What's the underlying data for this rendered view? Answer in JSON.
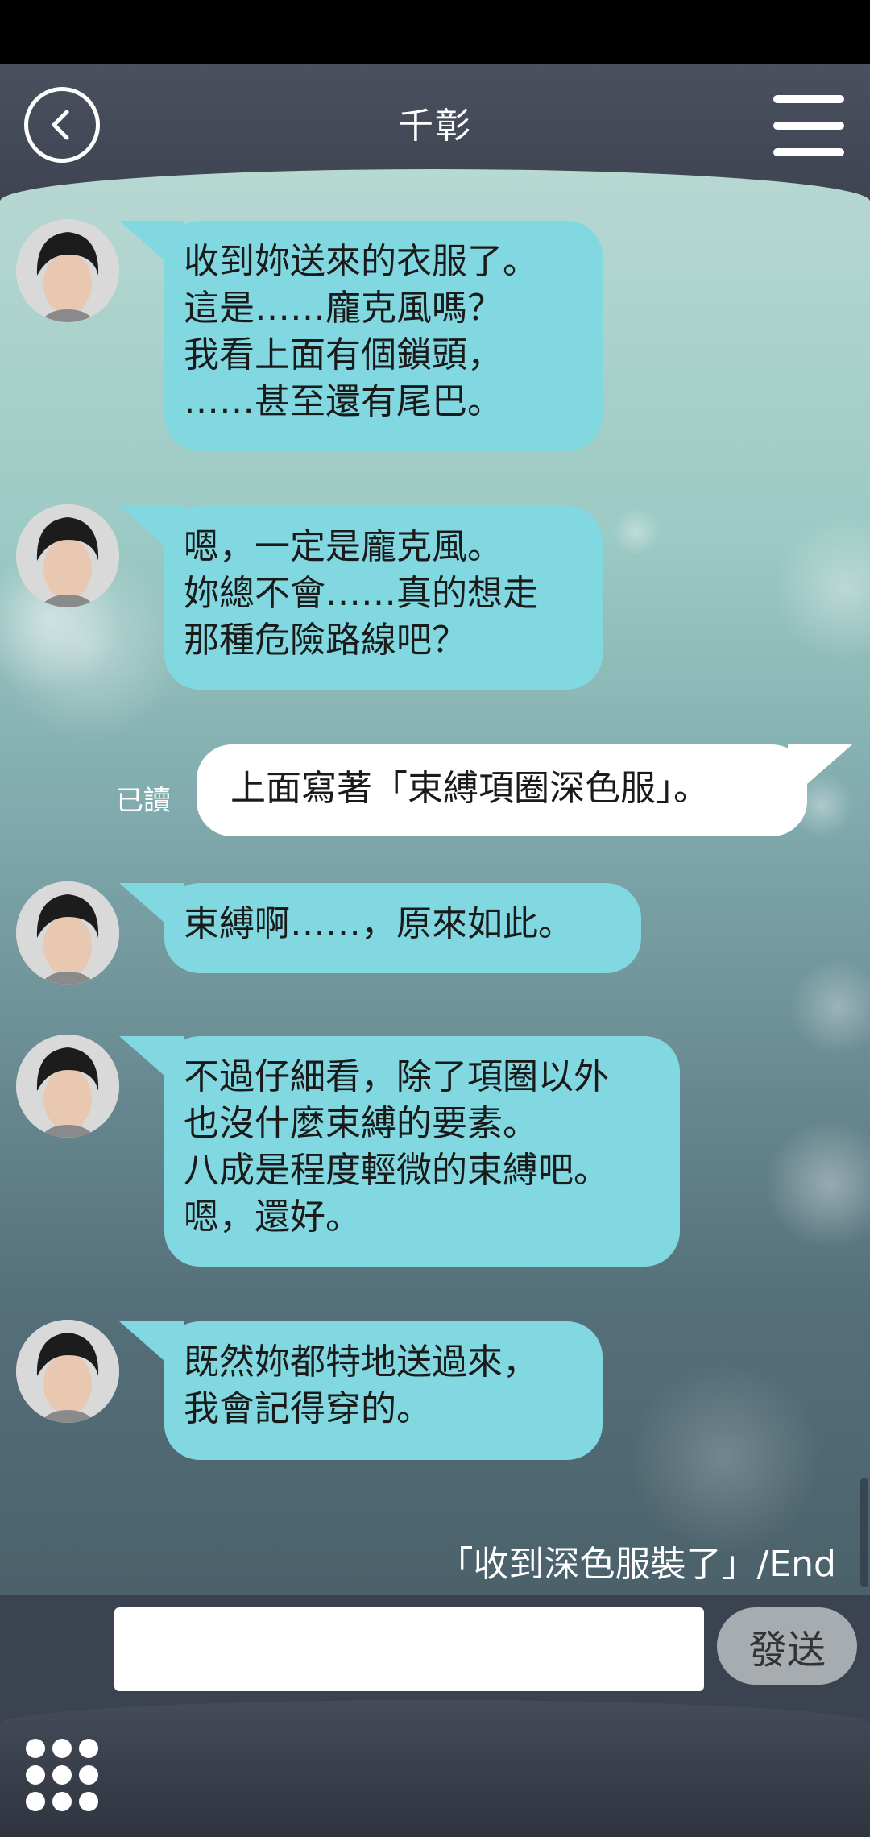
{
  "header": {
    "title": "千彰"
  },
  "messages": [
    {
      "sender": "contact",
      "text": "收到妳送來的衣服了。\n這是……龐克風嗎？\n我看上面有個鎖頭，\n……甚至還有尾巴。"
    },
    {
      "sender": "contact",
      "text": "嗯，一定是龐克風。\n妳總不會……真的想走\n那種危險路線吧？"
    },
    {
      "sender": "user",
      "text": "上面寫著「束縛項圈深色服」。",
      "status": "已讀"
    },
    {
      "sender": "contact",
      "text": "束縛啊……，原來如此。"
    },
    {
      "sender": "contact",
      "text": "不過仔細看，除了項圈以外\n也沒什麼束縛的要素。\n八成是程度輕微的束縛吧。\n嗯，還好。"
    },
    {
      "sender": "contact",
      "text": "既然妳都特地送過來，\n我會記得穿的。"
    }
  ],
  "end_label": "「收到深色服裝了」/End",
  "input": {
    "value": "",
    "send_label": "發送"
  },
  "colors": {
    "contact_bubble": "#82d8e0",
    "user_bubble": "#ffffff",
    "header": "#3d4350"
  }
}
